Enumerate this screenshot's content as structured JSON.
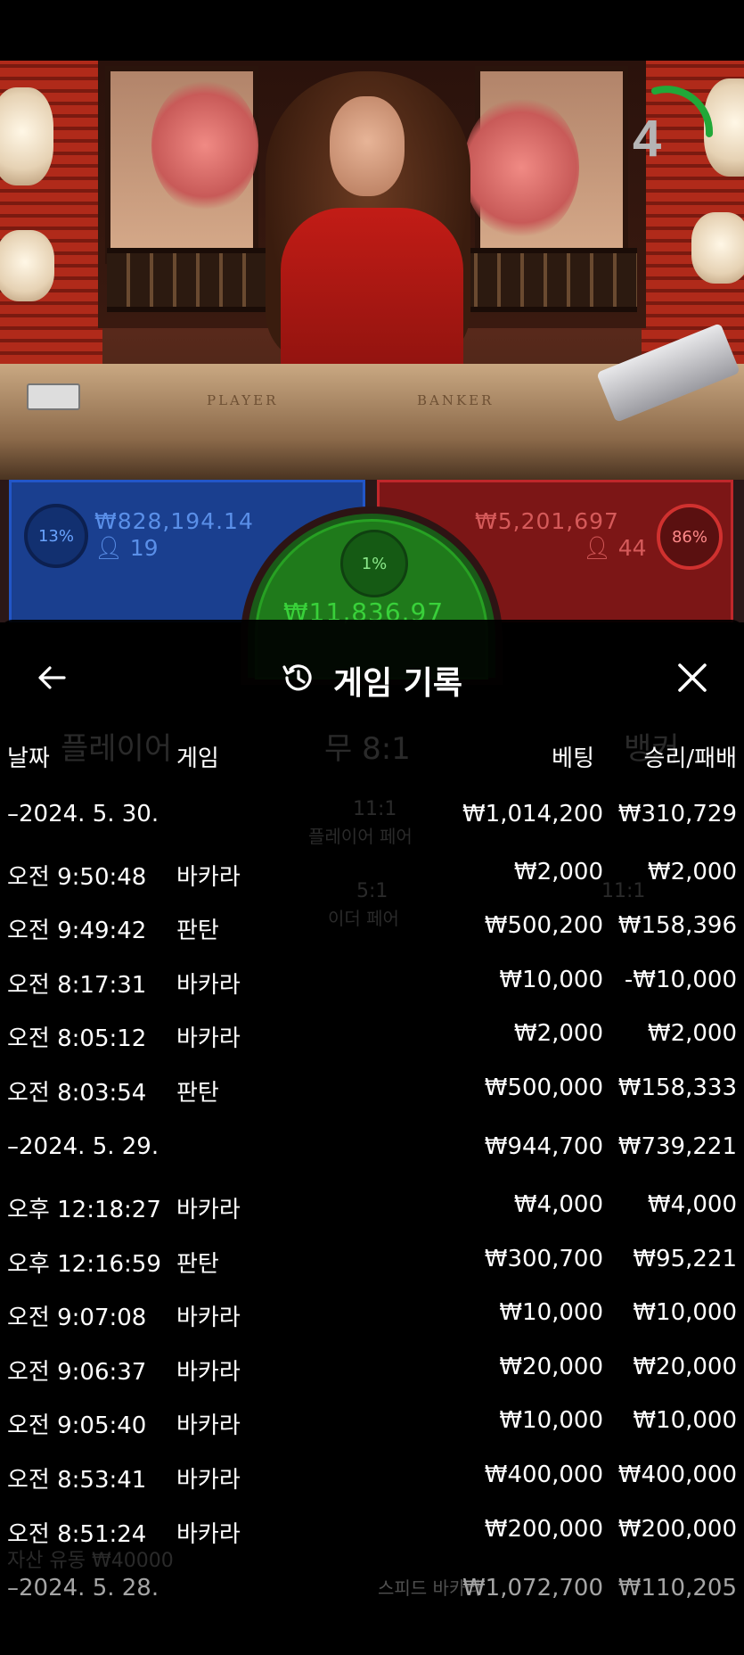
{
  "timer": {
    "value": "4"
  },
  "table_labels": {
    "player": "PLAYER",
    "banker": "BANKER"
  },
  "bets": {
    "player": {
      "percent": "13%",
      "amount": "₩828,194.14",
      "users": "19"
    },
    "banker": {
      "percent": "86%",
      "amount": "₩5,201,697",
      "users": "44"
    },
    "tie": {
      "percent": "1%",
      "amount": "₩11,836.97"
    }
  },
  "background_faded": {
    "player_label": "플레이어",
    "tie_label": "무 8:1",
    "banker_label": "뱅커",
    "player_pair": "11:1",
    "player_pair_label": "플레이어 페어",
    "either_pair": "5:1",
    "either_pair_label": "이더 페어",
    "player_pair_right": "11:1",
    "footer": "자산 유동 ₩40000",
    "footer_right": "스피드 바카라"
  },
  "history": {
    "title": "게임 기록",
    "columns": {
      "date": "날짜",
      "game": "게임",
      "bet": "베팅",
      "winloss": "승리/패배"
    },
    "rows": [
      {
        "type": "day",
        "date": "–2024. 5. 30.",
        "game": "",
        "bet": "₩1,014,200",
        "win": "₩310,729"
      },
      {
        "type": "entry",
        "date": "오전 9:50:48",
        "game": "바카라",
        "bet": "₩2,000",
        "win": "₩2,000"
      },
      {
        "type": "entry",
        "date": "오전 9:49:42",
        "game": "판탄",
        "bet": "₩500,200",
        "win": "₩158,396"
      },
      {
        "type": "entry",
        "date": "오전 8:17:31",
        "game": "바카라",
        "bet": "₩10,000",
        "win": "-₩10,000"
      },
      {
        "type": "entry",
        "date": "오전 8:05:12",
        "game": "바카라",
        "bet": "₩2,000",
        "win": "₩2,000"
      },
      {
        "type": "entry",
        "date": "오전 8:03:54",
        "game": "판탄",
        "bet": "₩500,000",
        "win": "₩158,333"
      },
      {
        "type": "day",
        "date": "–2024. 5. 29.",
        "game": "",
        "bet": "₩944,700",
        "win": "₩739,221"
      },
      {
        "type": "entry",
        "date": "오후 12:18:27",
        "game": "바카라",
        "bet": "₩4,000",
        "win": "₩4,000"
      },
      {
        "type": "entry",
        "date": "오후 12:16:59",
        "game": "판탄",
        "bet": "₩300,700",
        "win": "₩95,221"
      },
      {
        "type": "entry",
        "date": "오전 9:07:08",
        "game": "바카라",
        "bet": "₩10,000",
        "win": "₩10,000"
      },
      {
        "type": "entry",
        "date": "오전 9:06:37",
        "game": "바카라",
        "bet": "₩20,000",
        "win": "₩20,000"
      },
      {
        "type": "entry",
        "date": "오전 9:05:40",
        "game": "바카라",
        "bet": "₩10,000",
        "win": "₩10,000"
      },
      {
        "type": "entry",
        "date": "오전 8:53:41",
        "game": "바카라",
        "bet": "₩400,000",
        "win": "₩400,000"
      },
      {
        "type": "entry",
        "date": "오전 8:51:24",
        "game": "바카라",
        "bet": "₩200,000",
        "win": "₩200,000"
      },
      {
        "type": "day",
        "date": "–2024. 5. 28.",
        "game": "",
        "bet": "₩1,072,700",
        "win": "₩110,205"
      }
    ]
  }
}
